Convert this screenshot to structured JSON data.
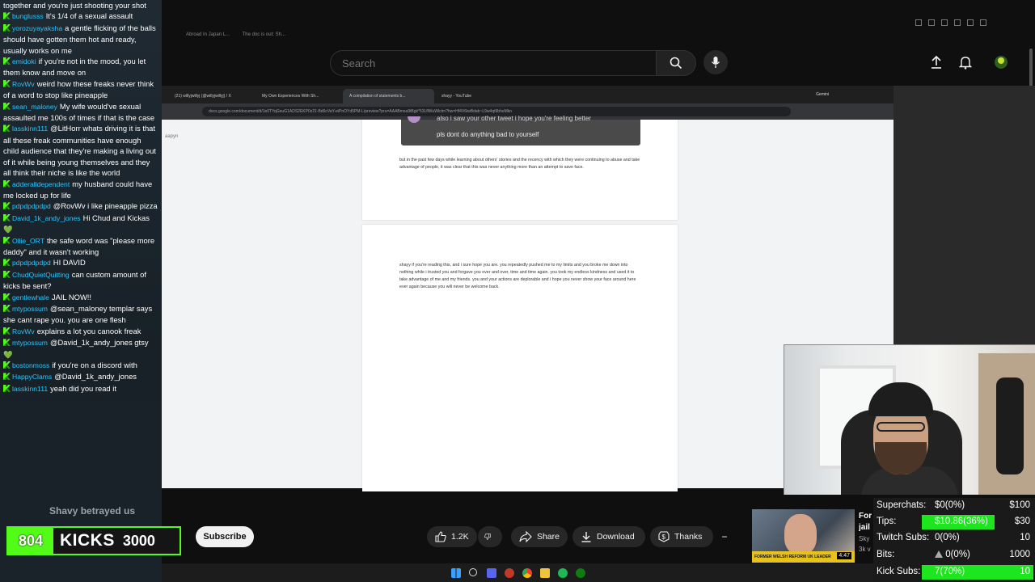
{
  "chat": {
    "messages": [
      {
        "user": "",
        "text": "together and you're just shooting your shot"
      },
      {
        "user": "bunglusss",
        "text": "It's 1/4 of a sexual assault"
      },
      {
        "user": "yorozuyayaksha",
        "text": "a gentle flicking of the balls should have gotten them hot and ready, usually works on me"
      },
      {
        "user": "emidoki",
        "text": "if you're not in the mood, you let them know and move on"
      },
      {
        "user": "RovWv",
        "text": "weird how these freaks never think of a word to stop like pineapple"
      },
      {
        "user": "sean_maloney",
        "text": "My wife would've sexual assaulted me 100s of times if that is the case"
      },
      {
        "user": "lasskinn111",
        "text": "@LitHorr whats driving it is that all these freak communities have enough child audience that they're making a living out of it while being young themselves and they all think their niche is like the world"
      },
      {
        "user": "adderalldependent",
        "text": "my husband could have me locked up for life"
      },
      {
        "user": "pdpdpdpdpd",
        "text": "@RovWv i like pineapple pizza"
      },
      {
        "user": "David_1k_andy_jones",
        "text": "Hi Chud and Kickas 💚"
      },
      {
        "user": "Ollie_ORT",
        "text": "the safe word was \"please more daddy\" and it wasn't working"
      },
      {
        "user": "pdpdpdpdpd",
        "text": "HI DAVID"
      },
      {
        "user": "ChudQuietQuitting",
        "text": "can custom amount of kicks be sent?"
      },
      {
        "user": "gentlewhale",
        "text": "JAIL NOW!!"
      },
      {
        "user": "mtypossum",
        "text": "@sean_maloney templar says she cant rape you. you are one flesh"
      },
      {
        "user": "RovWv",
        "text": "explains a lot you canook freak"
      },
      {
        "user": "mtypossum",
        "text": "@David_1k_andy_jones gtsy 💚"
      },
      {
        "user": "bostonmoss",
        "text": "if you're on a discord with"
      },
      {
        "user": "HappyClams",
        "text": "@David_1k_andy_jones"
      },
      {
        "user": "lasskinn111",
        "text": "yeah did you read it"
      }
    ]
  },
  "alert": {
    "text": "Shavy betrayed us"
  },
  "kicks": {
    "count": "804",
    "label": "KICKS",
    "goal": "3000"
  },
  "youtube": {
    "search_placeholder": "Search",
    "bookmarks": [
      "Abroad In Japan L...",
      "The doc is out: Sh..."
    ],
    "subscribe": "Subscribe",
    "likes": "1.2K",
    "share": "Share",
    "download": "Download",
    "thanks": "Thanks"
  },
  "inner_browser": {
    "tabs": [
      "(21) willyjwillyj (@willyjwillyj) / X",
      "My Own Experiences With Sh...",
      "A compilation of statements b...",
      "shayy - YouTube"
    ],
    "url": "docs.google.com/document/d/1e0TYqGeuG1ADS2EKP0z21-Bd6cVaY-eiPnOYd5PM-L/preview?pru=AAABmxa9tBgk*53LflWuWlctm?hw=Hf4V6iwBdab~L9w4qt9bheMkn",
    "gemini": "Gemini",
    "outline": "aapyn"
  },
  "doc": {
    "dm_line1": "also i saw your other tweet i hope you're feeling better",
    "dm_line2": "pls dont do anything bad to yourself",
    "para1": "but in the past few days while learning about others' stories and the recency with which they were continuing to abuse and take advantage of people, it was clear that this was never anything more than an attempt to save face.",
    "para2": "shayy if you're reading this, and i sure hope you are. you repeatedly pushed me to my limits and you broke me down into nothing while i trusted you and forgave you over and over, time and time again. you took my endless kindness and used it to take advantage of me and my friends. you and your actions are deplorable and i hope you never show your face around here ever again because you will never be welcome back."
  },
  "related": {
    "title": "For jail",
    "meta1": "Sky",
    "meta2": "3k v",
    "duration": "4:47",
    "banner": "FORMER WELSH REFORM UK LEADER"
  },
  "stats": {
    "superchats": {
      "label": "Superchats:",
      "value": "$0(0%)",
      "goal": "$100",
      "fraction": 0
    },
    "tips": {
      "label": "Tips:",
      "value": "$10.86(36%)",
      "goal": "$30",
      "fraction": 0.36
    },
    "twitch": {
      "label": "Twitch Subs:",
      "value": "0(0%)",
      "goal": "10",
      "fraction": 0
    },
    "bits": {
      "label": "Bits:",
      "value": "0(0%)",
      "goal": "1000",
      "fraction": 0
    },
    "kick": {
      "label": "Kick Subs:",
      "value": "7(70%)",
      "goal": "10",
      "fraction": 0.7
    }
  },
  "colors": {
    "kick_green": "#53fc18",
    "username_blue": "#29c6ff",
    "stat_green": "#1ee61e"
  }
}
